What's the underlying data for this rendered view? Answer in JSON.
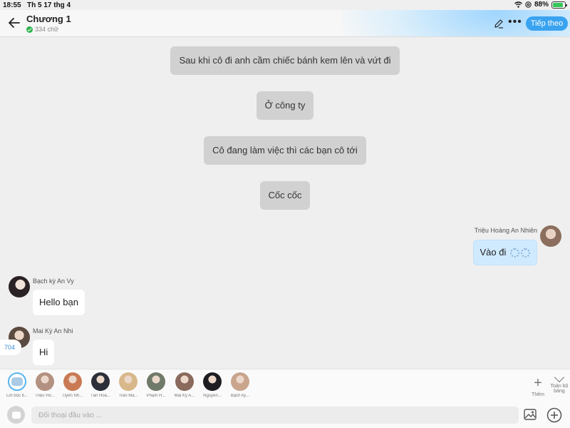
{
  "status_bar": {
    "time": "18:55",
    "date": "Th 5 17 thg 4",
    "battery": "88%",
    "battery_level": 0.88
  },
  "header": {
    "title": "Chương 1",
    "word_count": "334 chữ",
    "next_label": "Tiếp theo",
    "more": "•••"
  },
  "narrations": [
    {
      "text": "Sau khi cô đi anh cầm chiếc bánh kem lên và vứt đi"
    },
    {
      "text": "Ở công ty"
    },
    {
      "text": "Cô đang làm việc thì các bạn cô tới"
    },
    {
      "text": "Cốc cốc"
    }
  ],
  "messages": [
    {
      "sender": "Triệu Hoàng An Nhiên",
      "text": "Vào đi",
      "side": "right"
    },
    {
      "sender": "Bạch kỳ An Vy",
      "text": "Hello bạn",
      "side": "left"
    },
    {
      "sender": "Mai Kỳ An Nhi",
      "text": "Hi",
      "side": "left"
    }
  ],
  "counter": "704",
  "characters": [
    {
      "name": "Lời bộc b...",
      "color": "#a9cbe6"
    },
    {
      "name": "Triệu Ho...",
      "color": "#b39181"
    },
    {
      "name": "Uyên Nh...",
      "color": "#c97a55"
    },
    {
      "name": "Tân Hoà...",
      "color": "#2c2f3a"
    },
    {
      "name": "Trần Mẫ...",
      "color": "#d8b88a"
    },
    {
      "name": "Phạm H...",
      "color": "#6f7a6a"
    },
    {
      "name": "Mai Kỳ A...",
      "color": "#8a6a5c"
    },
    {
      "name": "Nguyễn...",
      "color": "#1e1e22"
    },
    {
      "name": "Bạch kỳ...",
      "color": "#c9a58e"
    }
  ],
  "char_controls": {
    "add_label": "Thêm",
    "full_label": "Toàn bộ bảng"
  },
  "input": {
    "placeholder": "Đối thoại đầu vào ..."
  },
  "colors": {
    "accent": "#3aa3f0",
    "narration_bg": "#d1d1d1",
    "outgoing_bg": "#cfeaff"
  }
}
